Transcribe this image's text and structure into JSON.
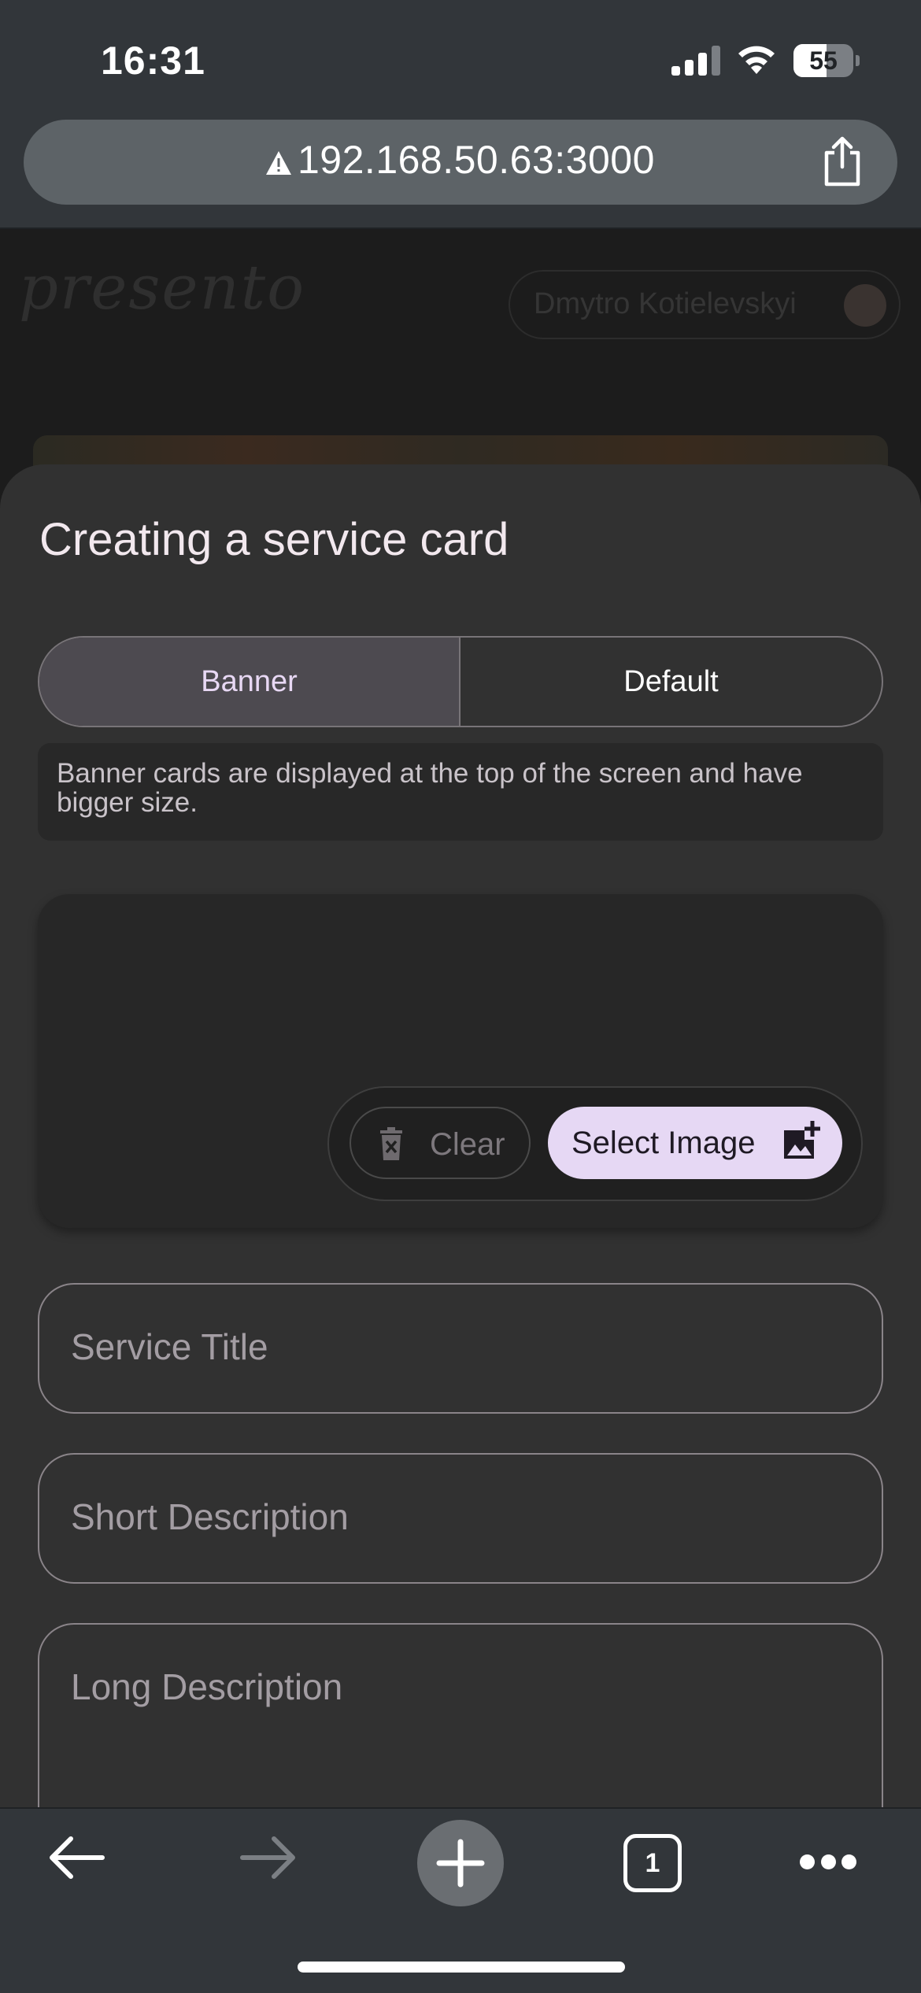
{
  "status_bar": {
    "time": "16:31",
    "battery_level": "55",
    "icons": [
      "cellular-signal-icon",
      "wifi-icon",
      "battery-icon"
    ]
  },
  "browser": {
    "url": "192.168.50.63:3000",
    "icons": [
      "not-secure-warning-icon",
      "share-icon"
    ],
    "toolbar": {
      "tab_count": "1",
      "icons": [
        "back-arrow-icon",
        "forward-arrow-icon",
        "plus-icon",
        "tabs-icon",
        "more-icon"
      ]
    }
  },
  "background_page": {
    "logo": "presento",
    "user_name": "Dmytro Kotielevskyi"
  },
  "sheet": {
    "title": "Creating a service card",
    "segments": [
      {
        "label": "Banner",
        "selected": true
      },
      {
        "label": "Default",
        "selected": false
      }
    ],
    "hint": "Banner cards are displayed at the top of the screen and have bigger size.",
    "image_actions": {
      "clear_label": "Clear",
      "clear_icon": "delete-icon",
      "select_label": "Select Image",
      "select_icon": "add-photo-icon"
    },
    "fields": {
      "service_title": {
        "placeholder": "Service Title",
        "value": ""
      },
      "short_description": {
        "placeholder": "Short Description",
        "value": ""
      },
      "long_description": {
        "placeholder": "Long Description",
        "value": ""
      }
    }
  },
  "colors": {
    "sheet_background": "#313131",
    "selected_segment": "#4d4a50",
    "primary_button": "#e6d8f4",
    "title_text": "#f2e8ee"
  }
}
